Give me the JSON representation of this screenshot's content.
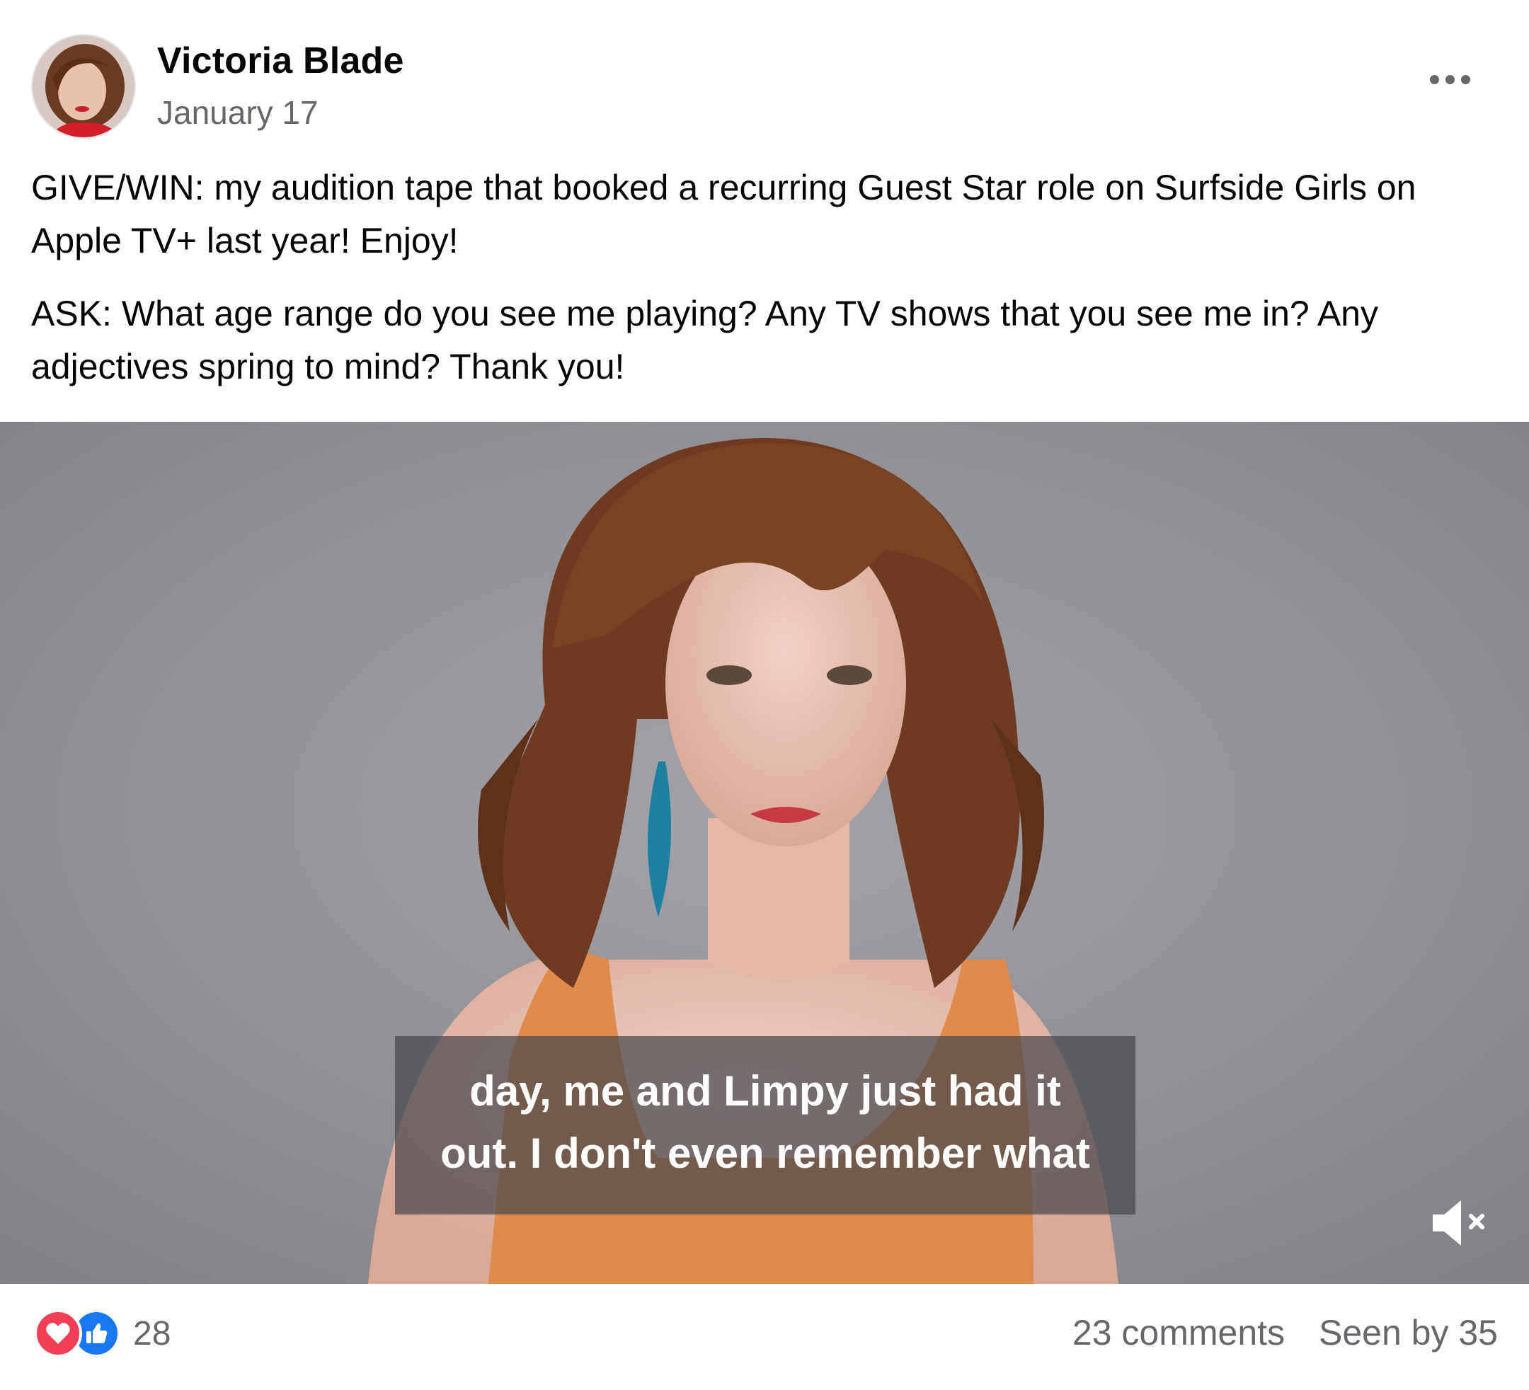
{
  "post": {
    "author": "Victoria Blade",
    "date": "January 17",
    "paragraphs": [
      "GIVE/WIN: my audition tape that booked a recurring Guest Star role on Surfside Girls on Apple TV+ last year! Enjoy!",
      "ASK: What age range do you see me playing? Any TV shows that you see me in? Any adjectives spring to mind? Thank you!"
    ]
  },
  "video": {
    "caption_line1": "day, me and Limpy just had it",
    "caption_line2": "out. I don't even remember what",
    "muted": true
  },
  "footer": {
    "reaction_count": "28",
    "comments": "23 comments",
    "seen_by": "Seen by 35"
  },
  "icons": {
    "more": "more-options-icon",
    "mute": "speaker-muted-icon",
    "love": "love-reaction-icon",
    "like": "like-reaction-icon"
  },
  "colors": {
    "love": "#f33e58",
    "like": "#1877f2",
    "secondary_text": "#65676b"
  }
}
